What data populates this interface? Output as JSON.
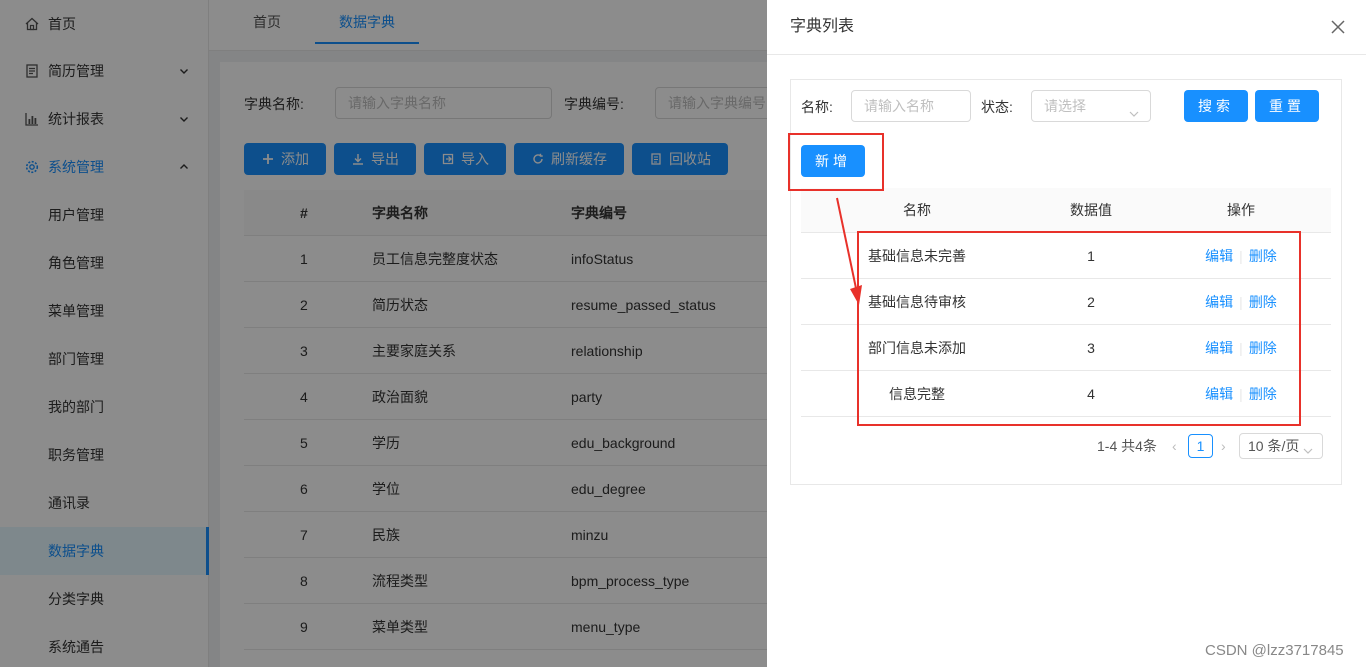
{
  "sidebar": {
    "items": [
      {
        "label": "首页",
        "icon": "home-icon"
      },
      {
        "label": "简历管理",
        "icon": "resume-icon"
      },
      {
        "label": "统计报表",
        "icon": "bar-chart-icon"
      },
      {
        "label": "系统管理",
        "icon": "gear-icon"
      },
      {
        "label": "用户管理"
      },
      {
        "label": "角色管理"
      },
      {
        "label": "菜单管理"
      },
      {
        "label": "部门管理"
      },
      {
        "label": "我的部门"
      },
      {
        "label": "职务管理"
      },
      {
        "label": "通讯录"
      },
      {
        "label": "数据字典"
      },
      {
        "label": "分类字典"
      },
      {
        "label": "系统通告"
      }
    ]
  },
  "tabs": [
    {
      "label": "首页"
    },
    {
      "label": "数据字典"
    }
  ],
  "filters": {
    "name_label": "字典名称:",
    "name_placeholder": "请输入字典名称",
    "code_label": "字典编号:",
    "code_placeholder": "请输入字典编号"
  },
  "toolbar": {
    "add": "添加",
    "export": "导出",
    "import": "导入",
    "refresh": "刷新缓存",
    "recycle": "回收站"
  },
  "main_table": {
    "headers": [
      "#",
      "字典名称",
      "字典编号"
    ],
    "rows": [
      {
        "no": "1",
        "name": "员工信息完整度状态",
        "code": "infoStatus"
      },
      {
        "no": "2",
        "name": "简历状态",
        "code": "resume_passed_status"
      },
      {
        "no": "3",
        "name": "主要家庭关系",
        "code": "relationship"
      },
      {
        "no": "4",
        "name": "政治面貌",
        "code": "party"
      },
      {
        "no": "5",
        "name": "学历",
        "code": "edu_background"
      },
      {
        "no": "6",
        "name": "学位",
        "code": "edu_degree"
      },
      {
        "no": "7",
        "name": "民族",
        "code": "minzu"
      },
      {
        "no": "8",
        "name": "流程类型",
        "code": "bpm_process_type"
      },
      {
        "no": "9",
        "name": "菜单类型",
        "code": "menu_type"
      }
    ]
  },
  "drawer": {
    "title": "字典列表",
    "name_label": "名称:",
    "name_placeholder": "请输入名称",
    "status_label": "状态:",
    "status_placeholder": "请选择",
    "search": "搜索",
    "reset": "重置",
    "add_new": "新增",
    "table": {
      "headers": [
        "名称",
        "数据值",
        "操作"
      ],
      "rows": [
        {
          "name": "基础信息未完善",
          "value": "1",
          "edit": "编辑",
          "delete": "删除"
        },
        {
          "name": "基础信息待审核",
          "value": "2",
          "edit": "编辑",
          "delete": "删除"
        },
        {
          "name": "部门信息未添加",
          "value": "3",
          "edit": "编辑",
          "delete": "删除"
        },
        {
          "name": "信息完整",
          "value": "4",
          "edit": "编辑",
          "delete": "删除"
        }
      ]
    },
    "pagination": {
      "total": "1-4 共4条",
      "current": "1",
      "page_size": "10 条/页"
    }
  },
  "watermark": "CSDN @lzz3717845",
  "colors": {
    "primary": "#1890ff",
    "annotation": "#e8312a"
  }
}
